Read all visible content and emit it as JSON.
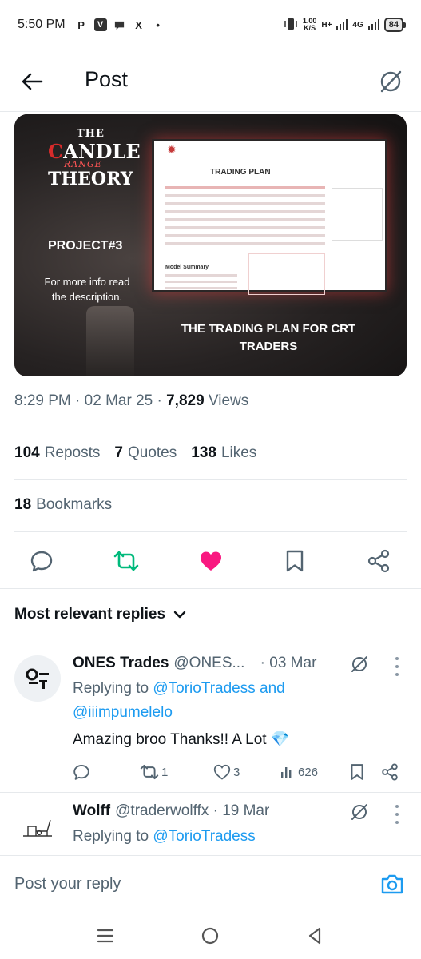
{
  "status_bar": {
    "time": "5:50 PM",
    "notification_icons": [
      "P",
      "V",
      "chat",
      "X",
      "•"
    ],
    "net_speed_value": "1.00",
    "net_speed_unit": "K/S",
    "network_h": "H+",
    "network_4g": "4G",
    "battery": "84"
  },
  "header": {
    "title": "Post"
  },
  "media": {
    "brand_the": "THE",
    "brand_candle_c": "C",
    "brand_candle_rest": "ANDLE",
    "brand_range": "RANGE",
    "brand_theory": "THEORY",
    "project": "PROJECT#3",
    "info": "For more info read the description.",
    "doc_title": "TRADING PLAN",
    "doc_model": "Model Summary",
    "caption": "THE TRADING PLAN FOR CRT TRADERS"
  },
  "meta": {
    "time": "8:29 PM",
    "sep1": "·",
    "date": "02 Mar 25",
    "sep2": "·",
    "views_count": "7,829",
    "views_label": "Views"
  },
  "stats": {
    "reposts_count": "104",
    "reposts_label": "Reposts",
    "quotes_count": "7",
    "quotes_label": "Quotes",
    "likes_count": "138",
    "likes_label": "Likes",
    "bookmarks_count": "18",
    "bookmarks_label": "Bookmarks"
  },
  "actions": {
    "reply_icon": "reply-icon",
    "repost_icon": "repost-icon",
    "like_icon": "heart-icon",
    "bookmark_icon": "bookmark-icon",
    "share_icon": "share-icon",
    "repost_color": "#00ba7c",
    "like_color": "#f91880"
  },
  "replies_header": {
    "label": "Most relevant replies"
  },
  "replies": [
    {
      "name": "ONES Trades",
      "handle": "@ONES...",
      "sep": "·",
      "date": "03 Mar",
      "replying_prefix": "Replying to",
      "mention_1": "@TorioTradess",
      "joiner": "and",
      "mention_2": "@iiimpumelelo",
      "text": "Amazing broo Thanks!! A Lot 💎",
      "reposts": "1",
      "likes": "3",
      "views": "626"
    },
    {
      "name": "Wolff",
      "handle": "@traderwolffx",
      "sep": "·",
      "date": "19 Mar",
      "replying_prefix": "Replying to",
      "mention_1": "@TorioTradess"
    }
  ],
  "composer": {
    "placeholder": "Post your reply"
  },
  "colors": {
    "accent": "#1d9bf0",
    "secondary_text": "#536471",
    "primary_text": "#0f1419"
  }
}
